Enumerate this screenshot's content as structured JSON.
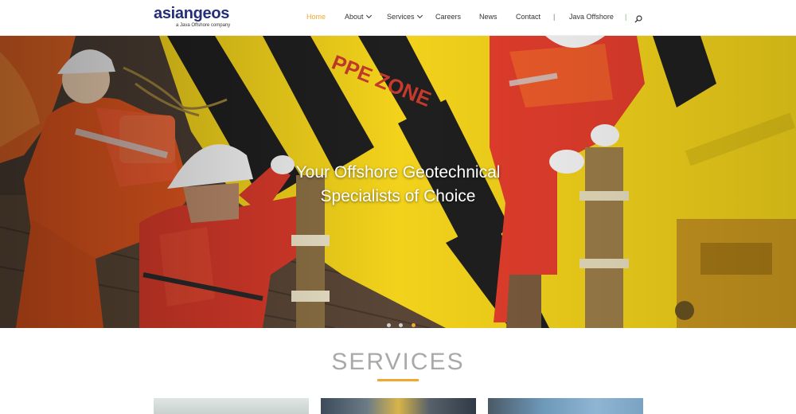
{
  "header": {
    "logo_text": "asiangeos",
    "logo_tagline": "a Java Offshore company",
    "nav": [
      {
        "label": "Home",
        "active": true,
        "has_dropdown": false
      },
      {
        "label": "About",
        "active": false,
        "has_dropdown": true
      },
      {
        "label": "Services",
        "active": false,
        "has_dropdown": true
      },
      {
        "label": "Careers",
        "active": false,
        "has_dropdown": false
      },
      {
        "label": "News",
        "active": false,
        "has_dropdown": false
      },
      {
        "label": "Contact",
        "active": false,
        "has_dropdown": false
      },
      {
        "label": "Java Offshore",
        "active": false,
        "has_dropdown": false
      }
    ],
    "separators": [
      "|",
      "|"
    ],
    "search_icon": "search-icon"
  },
  "hero": {
    "line1": "Your Offshore Geotechnical",
    "line2": "Specialists of Choice",
    "deck_marking": "PPE ZONE",
    "slides": 3,
    "active_slide": 3
  },
  "services": {
    "title": "SERVICES"
  },
  "colors": {
    "accent": "#f0a830",
    "brand": "#262d7a",
    "deck_yellow": "#f2d21b",
    "coverall_orange": "#e2561e"
  }
}
